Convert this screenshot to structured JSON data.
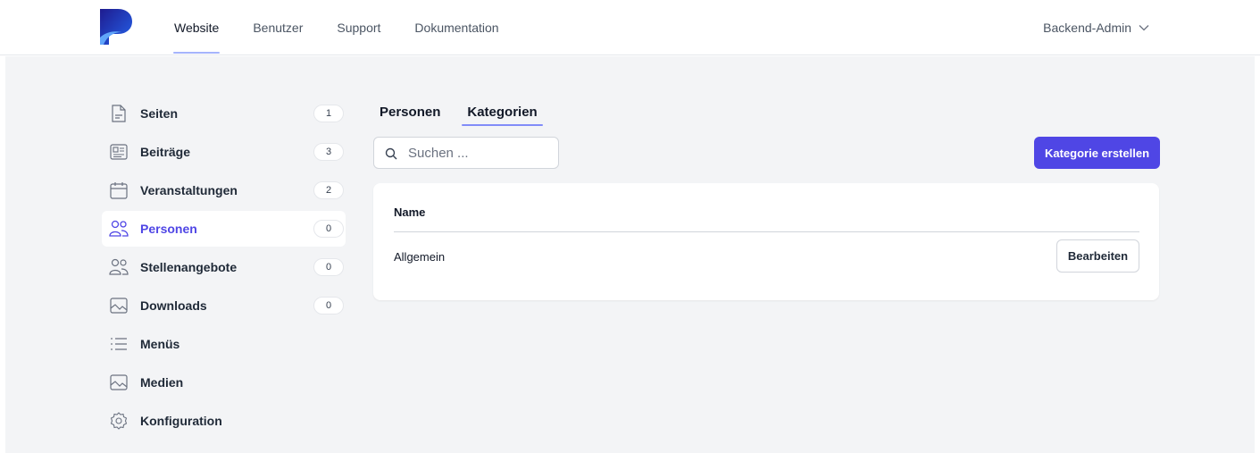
{
  "topnav": {
    "items": [
      {
        "label": "Website",
        "active": true
      },
      {
        "label": "Benutzer",
        "active": false
      },
      {
        "label": "Support",
        "active": false
      },
      {
        "label": "Dokumentation",
        "active": false
      }
    ],
    "user": "Backend-Admin"
  },
  "sidebar": {
    "items": [
      {
        "label": "Seiten",
        "count": "1",
        "icon": "page-icon"
      },
      {
        "label": "Beiträge",
        "count": "3",
        "icon": "newspaper-icon"
      },
      {
        "label": "Veranstaltungen",
        "count": "2",
        "icon": "calendar-icon"
      },
      {
        "label": "Personen",
        "count": "0",
        "icon": "users-icon",
        "active": true
      },
      {
        "label": "Stellenangebote",
        "count": "0",
        "icon": "users-outline-icon"
      },
      {
        "label": "Downloads",
        "count": "0",
        "icon": "image-icon"
      },
      {
        "label": "Menüs",
        "icon": "list-icon"
      },
      {
        "label": "Medien",
        "icon": "image-icon"
      },
      {
        "label": "Konfiguration",
        "icon": "gear-icon"
      }
    ]
  },
  "tabs": [
    {
      "label": "Personen",
      "active": false
    },
    {
      "label": "Kategorien",
      "active": true
    }
  ],
  "search": {
    "placeholder": "Suchen ..."
  },
  "create_button": "Kategorie erstellen",
  "table": {
    "column": "Name",
    "rows": [
      {
        "name": "Allgemein",
        "action": "Bearbeiten"
      }
    ]
  },
  "colors": {
    "accent": "#4f46e5",
    "active_underline": "#818cf8",
    "background": "#f3f4f6"
  }
}
